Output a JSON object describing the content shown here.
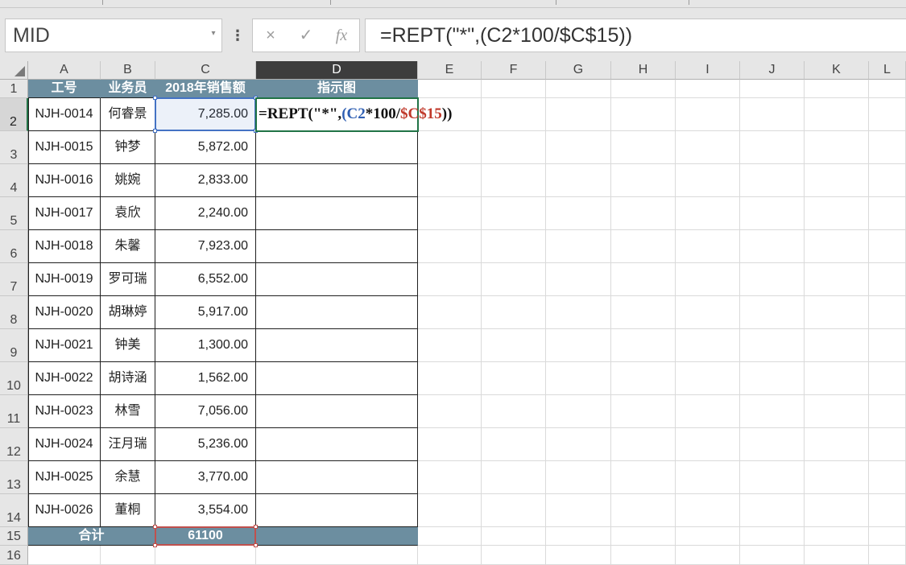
{
  "name_box": {
    "value": "MID"
  },
  "formula_bar": {
    "cancel_icon": "×",
    "enter_icon": "✓",
    "function_icon": "fx",
    "formula": "=REPT(\"*\",(C2*100/$C$15))"
  },
  "edit_formula": {
    "prefix": "=REPT(\"*\",",
    "open_paren": "(",
    "ref1": "C2",
    "middle": "*100/",
    "ref2": "$C$15",
    "close": "))"
  },
  "columns": [
    "A",
    "B",
    "C",
    "D",
    "E",
    "F",
    "G",
    "H",
    "I",
    "J",
    "K",
    "L"
  ],
  "rows": [
    "1",
    "2",
    "3",
    "4",
    "5",
    "6",
    "7",
    "8",
    "9",
    "10",
    "11",
    "12",
    "13",
    "14",
    "15",
    "16"
  ],
  "table": {
    "headers": [
      "工号",
      "业务员",
      "2018年销售额",
      "指示图"
    ],
    "records": [
      [
        "NJH-0014",
        "何睿景",
        "7,285.00"
      ],
      [
        "NJH-0015",
        "钟梦",
        "5,872.00"
      ],
      [
        "NJH-0016",
        "姚婉",
        "2,833.00"
      ],
      [
        "NJH-0017",
        "袁欣",
        "2,240.00"
      ],
      [
        "NJH-0018",
        "朱馨",
        "7,923.00"
      ],
      [
        "NJH-0019",
        "罗可瑞",
        "6,552.00"
      ],
      [
        "NJH-0020",
        "胡琳婷",
        "5,917.00"
      ],
      [
        "NJH-0021",
        "钟美",
        "1,300.00"
      ],
      [
        "NJH-0022",
        "胡诗涵",
        "1,562.00"
      ],
      [
        "NJH-0023",
        "林雪",
        "7,056.00"
      ],
      [
        "NJH-0024",
        "汪月瑞",
        "5,236.00"
      ],
      [
        "NJH-0025",
        "余慧",
        "3,770.00"
      ],
      [
        "NJH-0026",
        "董桐",
        "3,554.00"
      ]
    ],
    "total_label": "合计",
    "total_value": "61100"
  },
  "colors": {
    "header_fill": "#6c8ea0",
    "ref_blue": "#4472c4",
    "ref_red": "#c0504d",
    "active_green": "#217346"
  }
}
